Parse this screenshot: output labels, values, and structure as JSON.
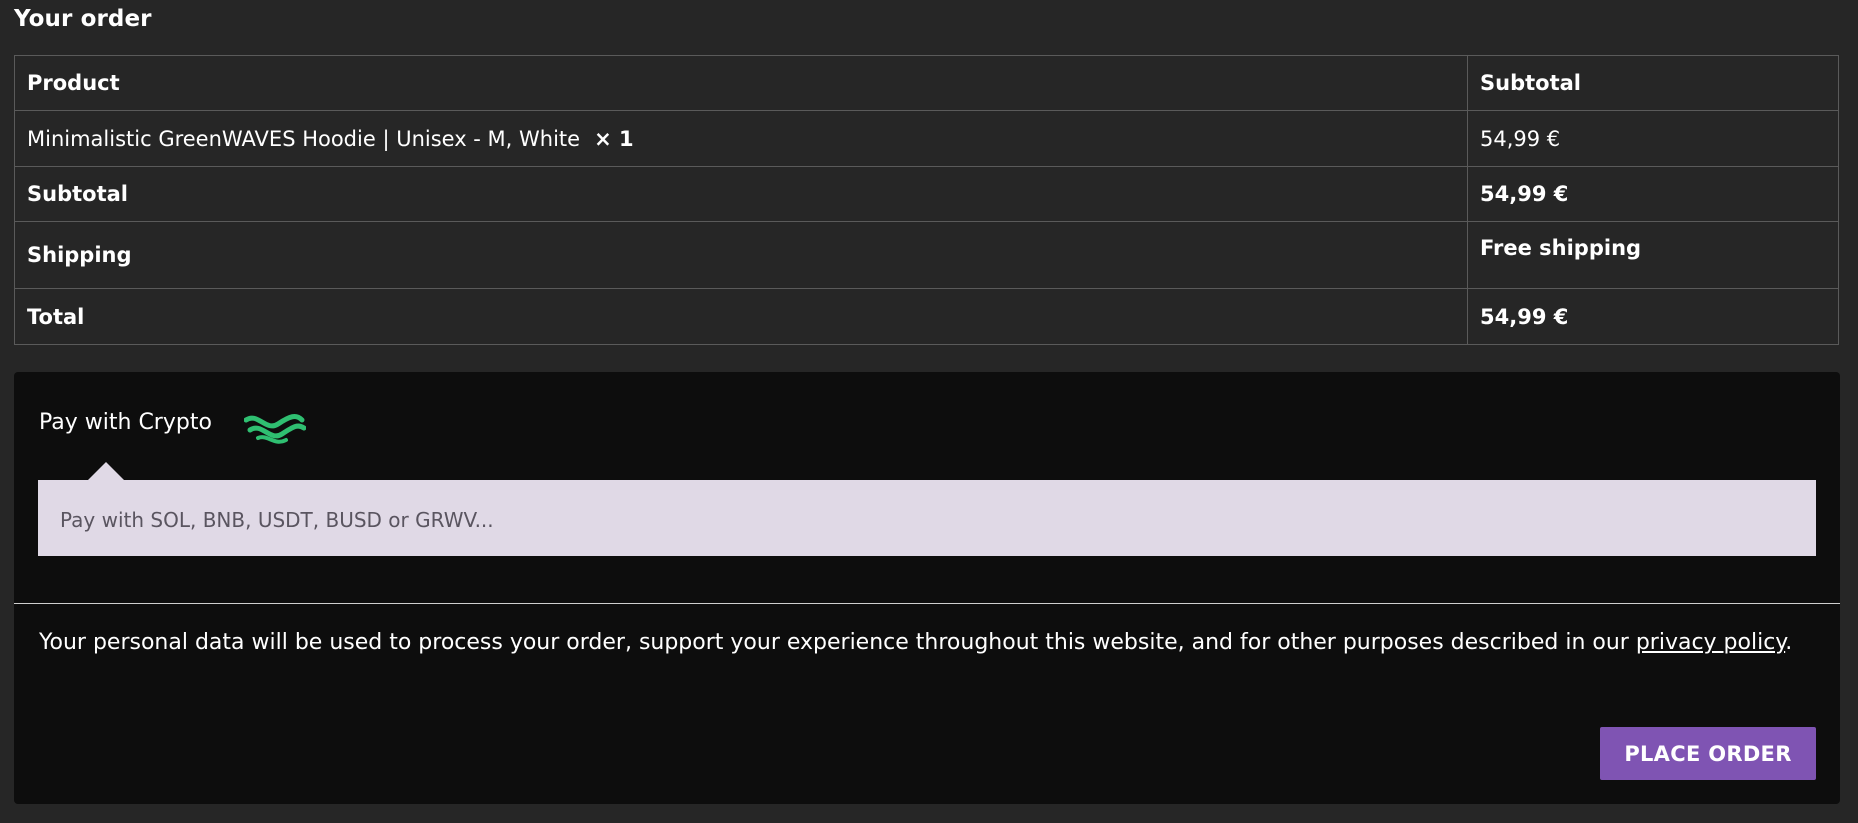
{
  "heading": "Your order",
  "table": {
    "headers": {
      "product": "Product",
      "subtotal": "Subtotal"
    },
    "item": {
      "name": "Minimalistic GreenWAVES Hoodie | Unisex - M, White",
      "quantity": "× 1",
      "subtotal": "54,99 €"
    },
    "subtotal": {
      "label": "Subtotal",
      "value": "54,99 €"
    },
    "shipping": {
      "label": "Shipping",
      "value": "Free shipping"
    },
    "total": {
      "label": "Total",
      "value": "54,99 €"
    }
  },
  "payment": {
    "method_label": "Pay with Crypto",
    "method_logo_icon": "greenwaves-logo-icon",
    "method_description": "Pay with SOL, BNB, USDT, BUSD or GRWV...",
    "logo_color": "#2fbf71"
  },
  "privacy": {
    "text_before": "Your personal data will be used to process your order, support your experience throughout this website, and for other purposes described in our ",
    "link_text": "privacy policy",
    "text_after": "."
  },
  "place_order_label": "PLACE ORDER",
  "colors": {
    "page_bg": "#262626",
    "panel_bg": "#0d0d0d",
    "button_bg": "#7f54b3",
    "method_box_bg": "#e0d9e6"
  }
}
